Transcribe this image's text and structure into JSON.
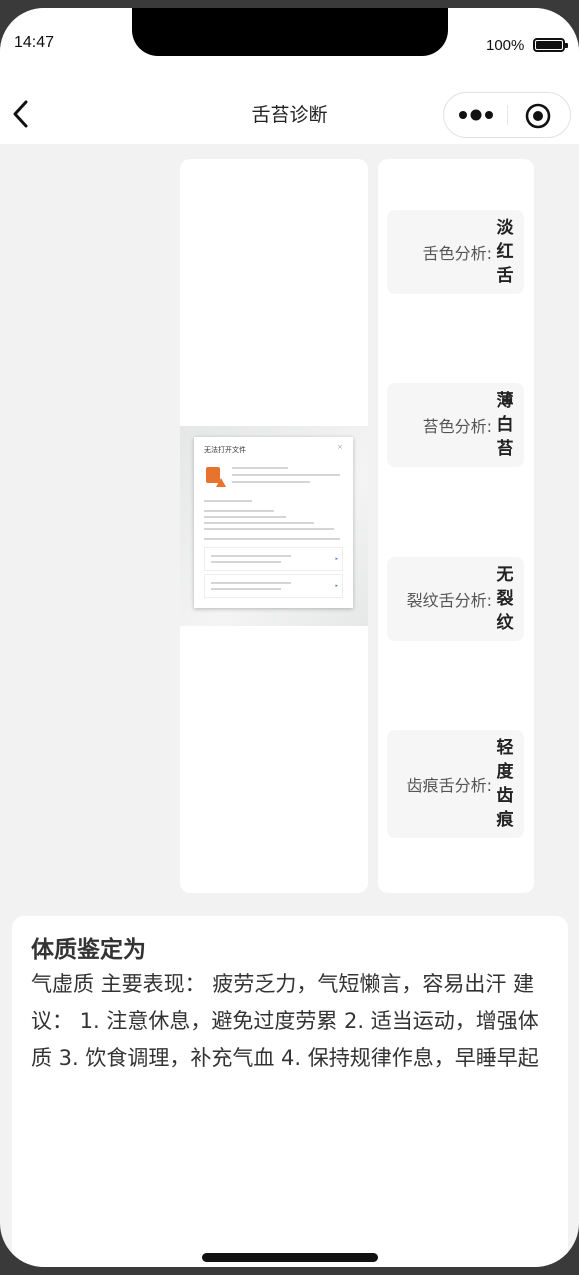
{
  "status_bar": {
    "time": "14:47",
    "battery_percent": "100%"
  },
  "nav": {
    "title": "舌苔诊断",
    "back_icon": "chevron-left-icon",
    "more_icon": "more-dots-icon",
    "close_icon": "target-close-icon"
  },
  "image_card": {
    "dialog_title": "无法打开文件",
    "dialog_close": "×"
  },
  "analysis": {
    "items": [
      {
        "label": "舌色分析:",
        "value": "淡红舌"
      },
      {
        "label": "苔色分析:",
        "value": "薄白苔"
      },
      {
        "label": "裂纹舌分析:",
        "value": "无裂纹"
      },
      {
        "label": "齿痕舌分析:",
        "value": "轻度齿痕"
      }
    ]
  },
  "result": {
    "title": "体质鉴定为",
    "body": "气虚质 主要表现： 疲劳乏力，气短懒言，容易出汗 建议： 1. 注意休息，避免过度劳累 2. 适当运动，增强体质 3. 饮食调理，补充气血 4. 保持规律作息，早睡早起"
  },
  "colors": {
    "page_bg": "#f2f2f2",
    "card_bg": "#ffffff",
    "analysis_item_bg": "#f6f6f6",
    "text_dark": "#222222",
    "text_label": "#555555"
  }
}
